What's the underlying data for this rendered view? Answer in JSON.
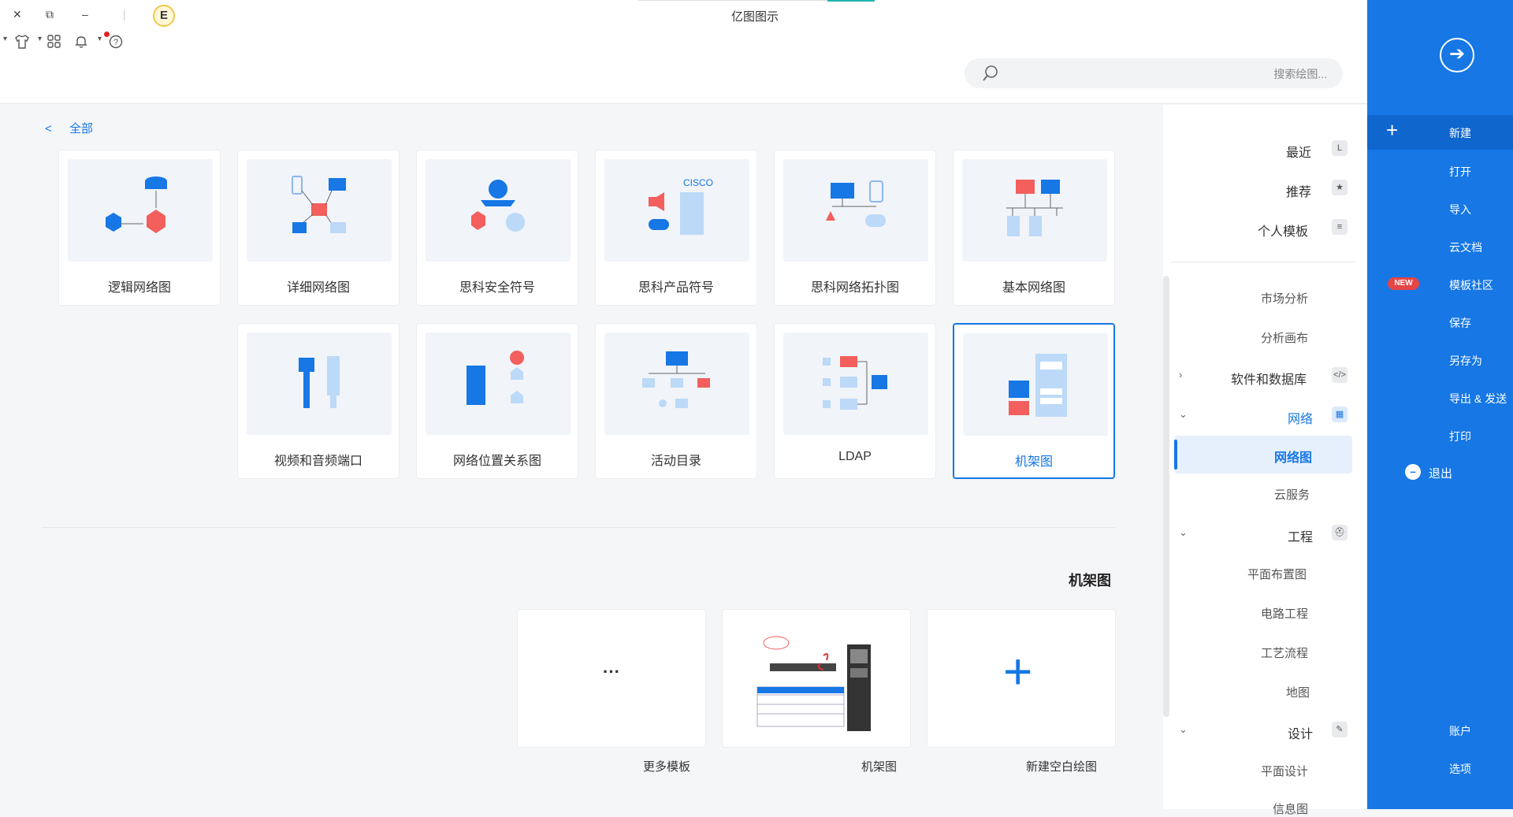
{
  "window": {
    "title": "亿图图示",
    "close": "✕",
    "restore": "⧉",
    "minimize": "–"
  },
  "toolbar": {
    "help": "?",
    "bell": "🔔",
    "apps": "⊞",
    "shirt": "👕",
    "avatar_letter": "E"
  },
  "search": {
    "placeholder": "搜索绘图..."
  },
  "rightnav": {
    "items": [
      {
        "label": "新建"
      },
      {
        "label": "打开"
      },
      {
        "label": "导入"
      },
      {
        "label": "云文档"
      },
      {
        "label": "模板社区",
        "badge": "NEW"
      },
      {
        "label": "保存"
      },
      {
        "label": "另存为"
      },
      {
        "label": "导出 & 发送"
      },
      {
        "label": "打印"
      },
      {
        "label": "退出"
      },
      {
        "label": "账户"
      },
      {
        "label": "选项"
      }
    ]
  },
  "categories": {
    "recent": "最近",
    "recommended": "推荐",
    "personal": "个人模板",
    "market": "市场分析",
    "canvas": "分析画布",
    "software_db": "软件和数据库",
    "network": "网络",
    "network_diagram": "网络图",
    "cloud": "云服务",
    "engineering": "工程",
    "floor_plan": "平面布置图",
    "electrical": "电路工程",
    "process": "工艺流程",
    "map": "地图",
    "design": "设计",
    "graphic_design": "平面设计",
    "info_graph": "信息图"
  },
  "breadcrumb": {
    "label": "全部",
    "arrow": "<"
  },
  "cards": [
    {
      "label": "基本网络图"
    },
    {
      "label": "思科网络拓扑图"
    },
    {
      "label": "思科产品符号"
    },
    {
      "label": "思科安全符号"
    },
    {
      "label": "详细网络图"
    },
    {
      "label": "逻辑网络图"
    },
    {
      "label": "机架图"
    },
    {
      "label": "LDAP"
    },
    {
      "label": "活动目录"
    },
    {
      "label": "网络位置关系图"
    },
    {
      "label": "视频和音频端口"
    }
  ],
  "section": {
    "title": "机架图"
  },
  "templates": [
    {
      "label": "新建空白绘图"
    },
    {
      "label": "机架图"
    },
    {
      "label": "更多模板"
    }
  ],
  "more_dots": "···",
  "colors": {
    "accent": "#1677e5",
    "red": "#f25f5c",
    "light_blue": "#bcd9f8"
  }
}
